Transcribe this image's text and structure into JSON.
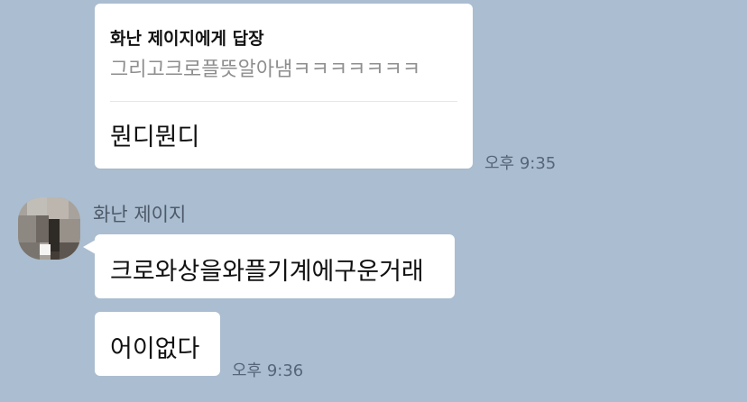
{
  "colors": {
    "background": "#abbdd0",
    "bubble": "#ffffff",
    "quote_text": "#8e8e8e",
    "time_text": "#56657a"
  },
  "messages": {
    "reply": {
      "reply_to": "화난 제이지에게 답장",
      "quoted_text": "그리고크로플뜻알아냄ㅋㅋㅋㅋㅋㅋㅋ",
      "text": "뭔디뭔디",
      "time": "오후 9:35"
    },
    "incoming": {
      "sender": "화난 제이지",
      "avatar_icon": "pixelated-profile-avatar",
      "items": [
        {
          "text": "크로와상을와플기계에구운거래"
        },
        {
          "text": "어이없다",
          "time": "오후 9:36"
        }
      ]
    }
  }
}
